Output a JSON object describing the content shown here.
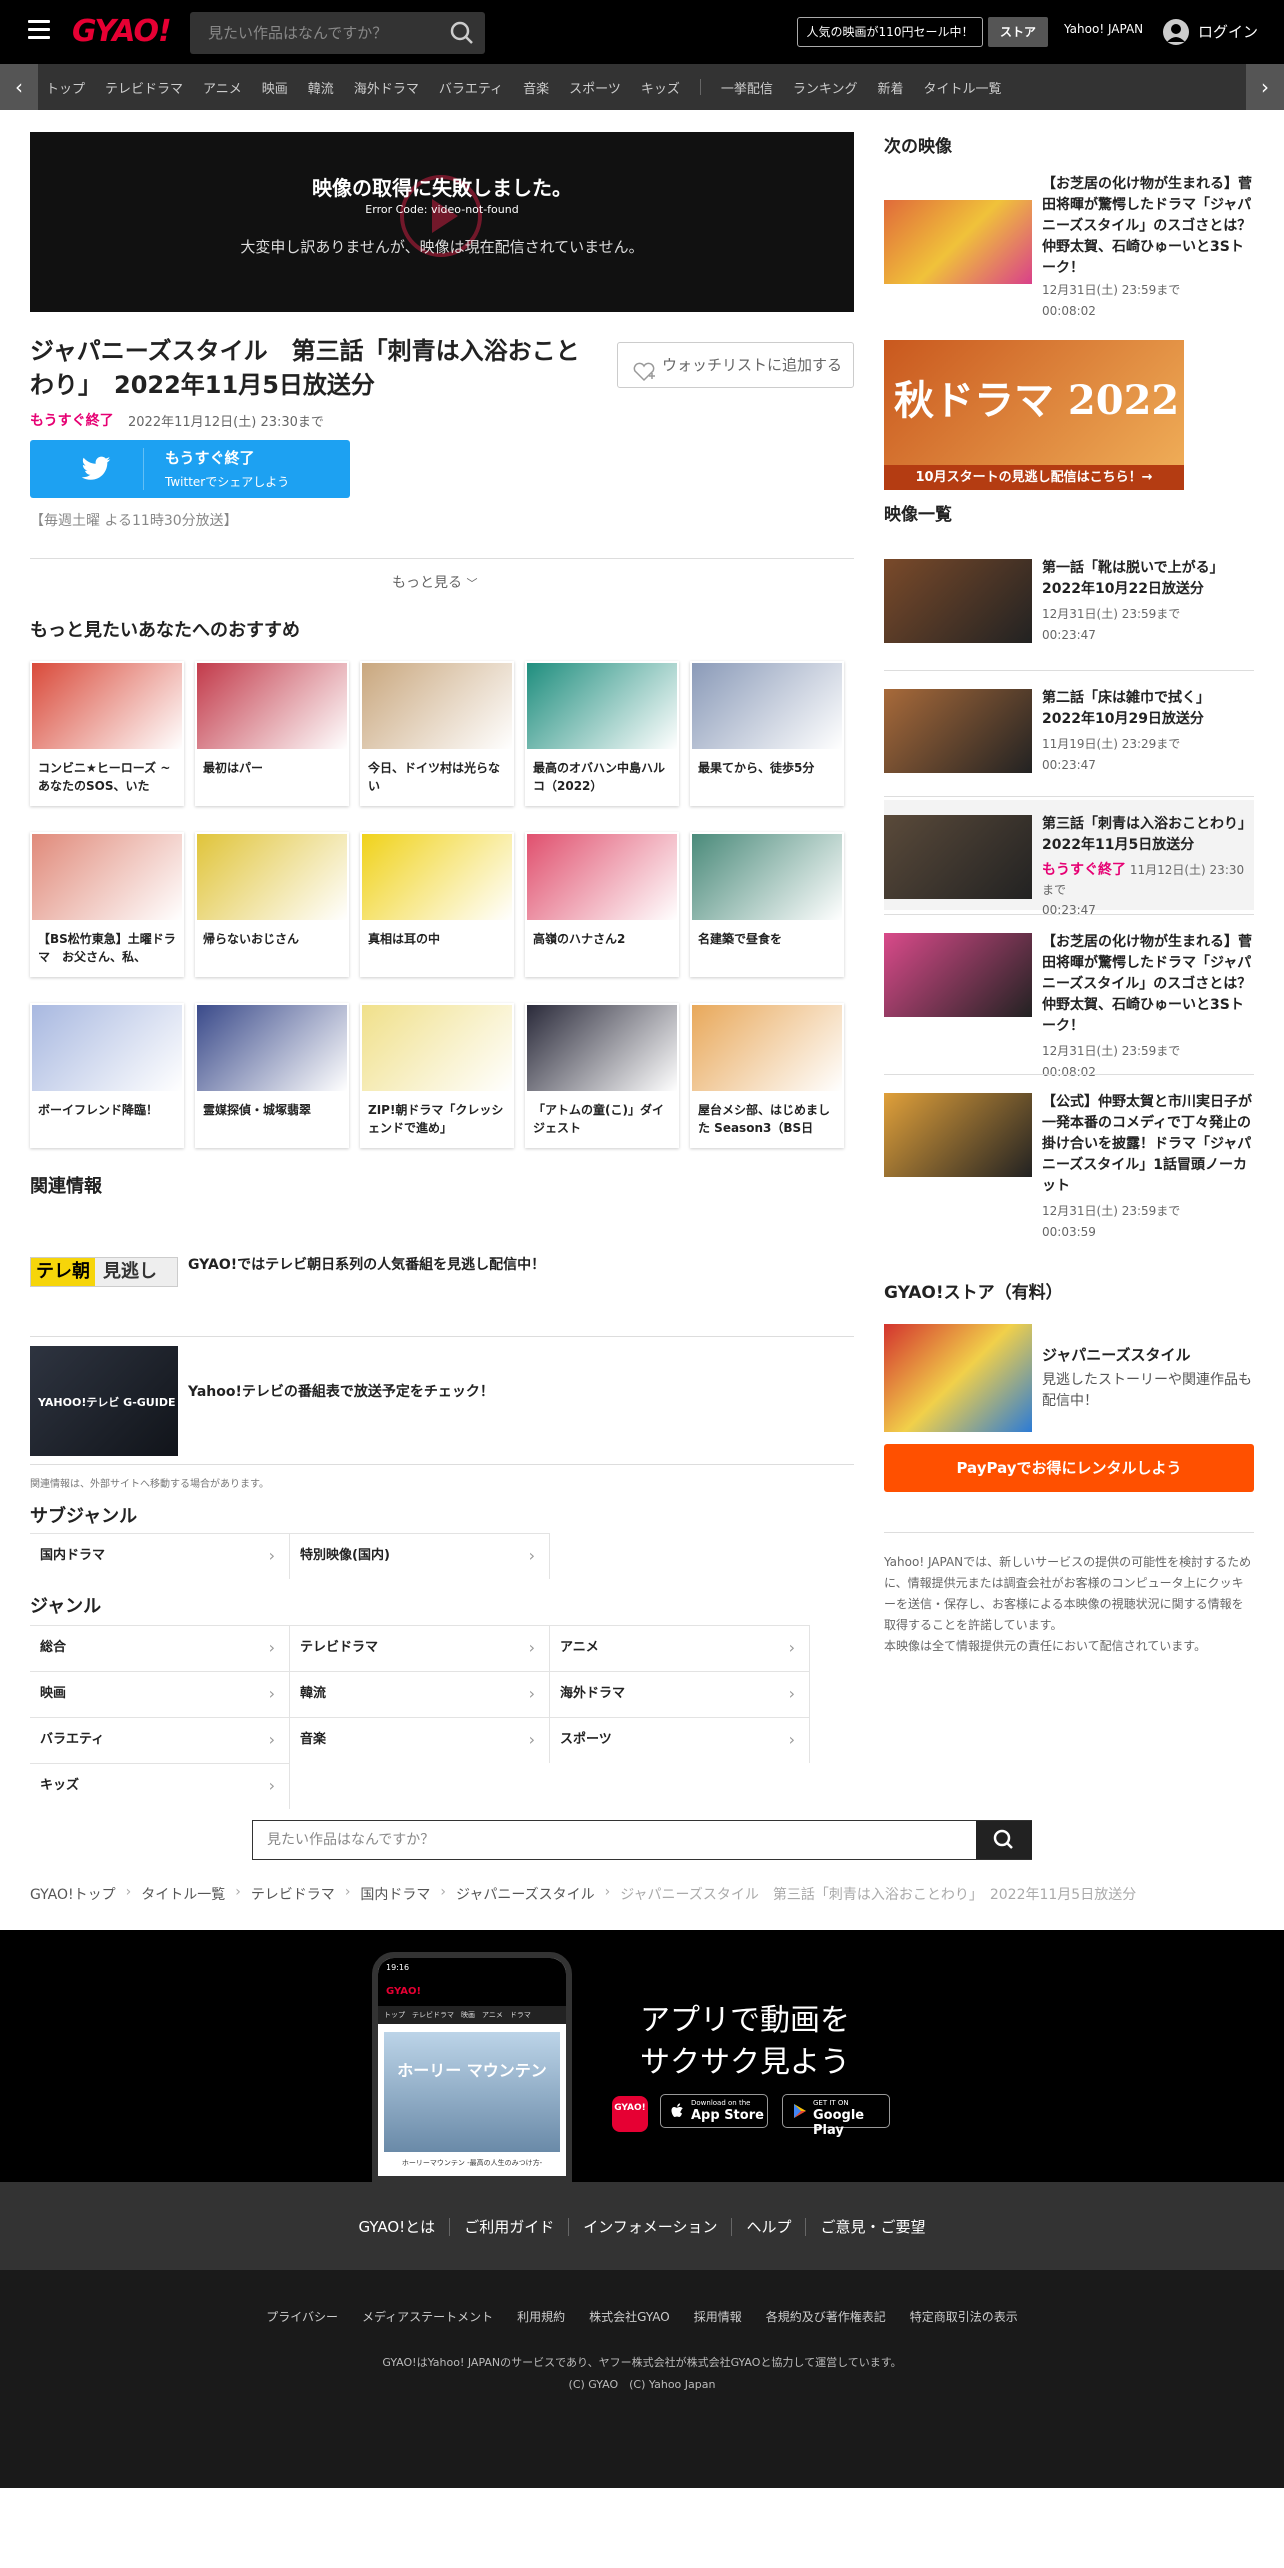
{
  "header": {
    "logo": "GYAO!",
    "search_placeholder": "見たい作品はなんですか？",
    "promo": "人気の映画が110円セール中！",
    "store": "ストア",
    "yahoo_japan": "Yahoo! JAPAN",
    "login": "ログイン"
  },
  "nav": {
    "items": [
      "トップ",
      "テレビドラマ",
      "アニメ",
      "映画",
      "韓流",
      "海外ドラマ",
      "バラエティ",
      "音楽",
      "スポーツ",
      "キッズ"
    ],
    "items2": [
      "一挙配信",
      "ランキング",
      "新着",
      "タイトル一覧"
    ]
  },
  "player": {
    "error_title": "映像の取得に失敗しました。",
    "error_code": "Error Code: video-not-found",
    "error_message": "大変申し訳ありませんが、映像は現在配信されていません。"
  },
  "video": {
    "title": "ジャパニーズスタイル　第三話「刺青は入浴おことわり」　2022年11月5日放送分",
    "watchlist": "ウォッチリストに追加する",
    "badge": "もうすぐ終了",
    "until": "2022年11月12日(土) 23:30まで",
    "twitter_main": "もうすぐ終了",
    "twitter_sub": "Twitterでシェアしよう",
    "schedule": "【毎週土曜 よる11時30分放送】",
    "more": "もっと見る"
  },
  "recommend": {
    "heading": "もっと見たいあなたへのおすすめ",
    "items": [
      {
        "title": "コンビニ★ヒーローズ ~あなたのSOS、いた",
        "color": "#d94a3a"
      },
      {
        "title": "最初はパー",
        "color": "#c23a4a"
      },
      {
        "title": "今日、ドイツ村は光らない",
        "color": "#c9a77e"
      },
      {
        "title": "最高のオバハン中島ハルコ（2022）",
        "color": "#1f8e7e"
      },
      {
        "title": "最果てから、徒歩5分",
        "color": "#8a9ab8"
      },
      {
        "title": "【BS松竹東急】土曜ドラマ　お父さん、私、",
        "color": "#e08a7a"
      },
      {
        "title": "帰らないおじさん",
        "color": "#e0c43a"
      },
      {
        "title": "真相は耳の中",
        "color": "#f0d21a"
      },
      {
        "title": "高嶺のハナさん2",
        "color": "#e0506e"
      },
      {
        "title": "名建築で昼食を",
        "color": "#4a8a7a"
      },
      {
        "title": "ボーイフレンド降臨！",
        "color": "#a8b8e0"
      },
      {
        "title": "霊媒探偵・城塚翡翠",
        "color": "#3a4a8a"
      },
      {
        "title": "ZIP!朝ドラマ「クレッシェンドで進め」",
        "color": "#f0e08a"
      },
      {
        "title": "「アトムの童(こ)」ダイジェスト",
        "color": "#2a2a3a"
      },
      {
        "title": "屋台メシ部、はじめました Season3（BS日",
        "color": "#e8a85a"
      }
    ]
  },
  "related": {
    "heading": "関連情報",
    "item1_logo_a": "テレ朝",
    "item1_logo_b": "見逃し",
    "item1": "GYAO!ではテレビ朝日系列の人気番組を見逃し配信中！",
    "item2_logo": "YAHOO!テレビ G-GUIDE",
    "item2": "Yahoo!テレビの番組表で放送予定をチェック！",
    "note": "関連情報は、外部サイトへ移動する場合があります。"
  },
  "subgenre": {
    "heading": "サブジャンル",
    "items": [
      "国内ドラマ",
      "特別映像(国内)"
    ]
  },
  "genre": {
    "heading": "ジャンル",
    "items": [
      "総合",
      "テレビドラマ",
      "アニメ",
      "映画",
      "韓流",
      "海外ドラマ",
      "バラエティ",
      "音楽",
      "スポーツ",
      "キッズ"
    ]
  },
  "bottom_search": {
    "placeholder": "見たい作品はなんですか？"
  },
  "breadcrumb": [
    "GYAO!トップ",
    "タイトル一覧",
    "テレビドラマ",
    "国内ドラマ",
    "ジャパニーズスタイル",
    "ジャパニーズスタイル　第三話「刺青は入浴おことわり」　2022年11月5日放送分"
  ],
  "next_video": {
    "heading": "次の映像",
    "title": "【お芝居の化け物が生まれる】菅田将暉が驚愕したドラマ「ジャパニーズスタイル」のスゴさとは？仲野太賀、石崎ひゅーいと3Sトーク！",
    "date": "12月31日(土) 23:59まで",
    "duration": "00:08:02",
    "banner_text": "秋ドラマ 2022",
    "banner_caption": "10月スタートの見逃し配信はこちら！→"
  },
  "video_list": {
    "heading": "映像一覧",
    "items": [
      {
        "title": "第一話「靴は脱いで上がる」　2022年10月22日放送分",
        "date": "12月31日(土) 23:59まで",
        "duration": "00:23:47",
        "badge": ""
      },
      {
        "title": "第二話「床は雑巾で拭く」　2022年10月29日放送分",
        "date": "11月19日(土) 23:29まで",
        "duration": "00:23:47",
        "badge": ""
      },
      {
        "title": "第三話「刺青は入浴おことわり」　2022年11月5日放送分",
        "date": "11月12日(土) 23:30まで",
        "duration": "00:23:47",
        "badge": "もうすぐ終了"
      },
      {
        "title": "【お芝居の化け物が生まれる】菅田将暉が驚愕したドラマ「ジャパニーズスタイル」のスゴさとは？仲野太賀、石崎ひゅーいと3Sトーク！",
        "date": "12月31日(土) 23:59まで",
        "duration": "00:08:02",
        "badge": ""
      },
      {
        "title": "【公式】仲野太賀と市川実日子が一発本番のコメディで丁々発止の掛け合いを披露！ドラマ「ジャパニーズスタイル」1話冒頭ノーカット",
        "date": "12月31日(土) 23:59まで",
        "duration": "00:03:59",
        "badge": ""
      }
    ]
  },
  "store_section": {
    "heading": "GYAO!ストア（有料）",
    "title": "ジャパニーズスタイル",
    "desc": "見逃したストーリーや関連作品も配信中！",
    "button": "PayPayでお得にレンタルしよう"
  },
  "disclaimer": "Yahoo! JAPANでは、新しいサービスの提供の可能性を検討するために、情報提供元または調査会社がお客様のコンピュータ上にクッキーを送信・保存し、お客様による本映像の視聴状況に関する情報を取得することを許諾しています。\n本映像は全て情報提供元の責任において配信されています。",
  "app": {
    "line1": "アプリで動画を",
    "line2": "サクサク見よう",
    "icon": "GYAO!",
    "appstore_small": "Download on the",
    "appstore": "App Store",
    "google_small": "GET IT ON",
    "google": "Google Play",
    "phone_poster": "ホーリー マウンテン",
    "phone_caption": "ホーリーマウンテン -最高の人生のみつけ方-"
  },
  "footer": {
    "links1": [
      "GYAO!とは",
      "ご利用ガイド",
      "インフォメーション",
      "ヘルプ",
      "ご意見・ご要望"
    ],
    "links2": [
      "プライバシー",
      "メディアステートメント",
      "利用規約",
      "株式会社GYAO",
      "採用情報",
      "各規約及び著作権表記",
      "特定商取引法の表示"
    ],
    "note": "GYAO!はYahoo! JAPANのサービスであり、ヤフー株式会社が株式会社GYAOと協力して運営しています。",
    "copyright": "(C) GYAO　(C) Yahoo Japan"
  }
}
